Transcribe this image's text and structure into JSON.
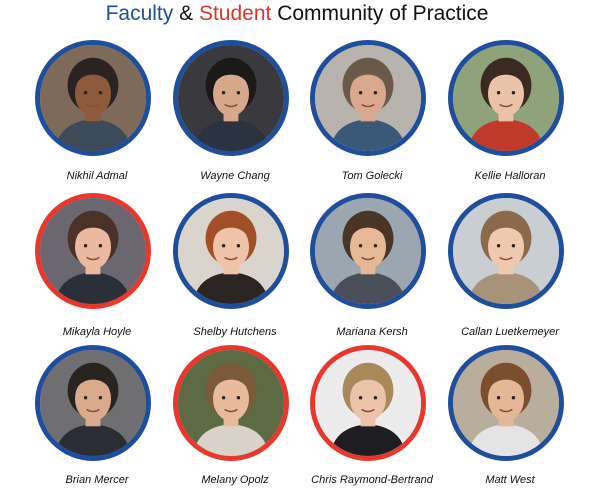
{
  "title": {
    "faculty_word": "Faculty",
    "amp": "&",
    "student_word": "Student",
    "rest": "Community of Practice"
  },
  "members": [
    {
      "name": "Nikhil  Admal",
      "role": "faculty",
      "bg": "#7d6a58",
      "skin": "#8d5a3c",
      "hair": "#2a2420",
      "shirt": "#3d4a5a",
      "icon": "person-photo-icon"
    },
    {
      "name": "Wayne Chang",
      "role": "faculty",
      "bg": "#3a3a3e",
      "skin": "#d7a98a",
      "hair": "#1c1a19",
      "shirt": "#2c3340",
      "icon": "person-photo-icon"
    },
    {
      "name": "Tom Golecki",
      "role": "faculty",
      "bg": "#b8b4ad",
      "skin": "#d9a88e",
      "hair": "#6b5a48",
      "shirt": "#3c5878",
      "icon": "person-photo-icon"
    },
    {
      "name": "Kellie Halloran",
      "role": "faculty",
      "bg": "#8fa37a",
      "skin": "#eac2a8",
      "hair": "#3b2a22",
      "shirt": "#c0392b",
      "icon": "person-photo-icon"
    },
    {
      "name": "Mikayla Hoyle",
      "role": "student",
      "bg": "#6b6770",
      "skin": "#eab9a0",
      "hair": "#4a3228",
      "shirt": "#2a2f3a",
      "icon": "person-photo-icon"
    },
    {
      "name": "Shelby Hutchens",
      "role": "faculty",
      "bg": "#d9d4cc",
      "skin": "#efc3a8",
      "hair": "#a24e26",
      "shirt": "#2a2422",
      "icon": "person-photo-icon"
    },
    {
      "name": "Mariana Kersh",
      "role": "faculty",
      "bg": "#9aa7b0",
      "skin": "#e7b896",
      "hair": "#4a3424",
      "shirt": "#4a4e58",
      "icon": "person-photo-icon"
    },
    {
      "name": "Callan Luetkemeyer",
      "role": "faculty",
      "bg": "#c9ced3",
      "skin": "#efc8b0",
      "hair": "#8a6a4a",
      "shirt": "#a89278",
      "icon": "person-photo-icon"
    },
    {
      "name": "Brian Mercer",
      "role": "faculty",
      "bg": "#6f6f72",
      "skin": "#d9ab8c",
      "hair": "#2a2420",
      "shirt": "#2a2d34",
      "icon": "person-photo-icon"
    },
    {
      "name": "Melany Opolz",
      "role": "student",
      "bg": "#5d6b45",
      "skin": "#e8bb9d",
      "hair": "#7a5a3a",
      "shirt": "#d8d2c8",
      "icon": "person-photo-icon"
    },
    {
      "name": "Chris Raymond-Bertrand",
      "role": "student",
      "bg": "#ececec",
      "skin": "#eac3a8",
      "hair": "#a88a5a",
      "shirt": "#1e1e22",
      "icon": "person-photo-icon"
    },
    {
      "name": "Matt West",
      "role": "faculty",
      "bg": "#b9ad9c",
      "skin": "#e4b796",
      "hair": "#7a4e2e",
      "shirt": "#e4e4e4",
      "icon": "person-photo-icon"
    }
  ]
}
